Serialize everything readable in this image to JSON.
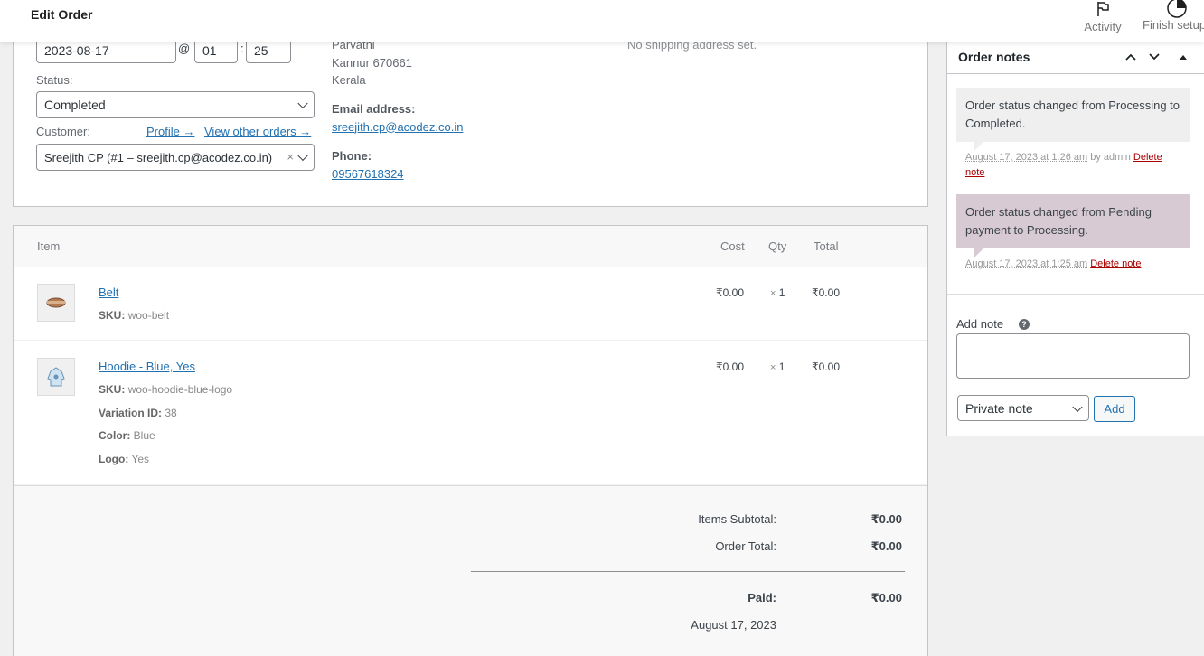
{
  "header": {
    "title": "Edit Order",
    "activity_label": "Activity",
    "finish_setup_label": "Finish setup"
  },
  "general": {
    "date": "2023-08-17",
    "at": "@",
    "hour": "01",
    "colon": ":",
    "minute": "25",
    "status_label": "Status:",
    "status_value": "Completed",
    "customer_label": "Customer:",
    "profile_link": "Profile →",
    "other_orders_link": "View other orders →",
    "customer_value": "Sreejith CP (#1 – sreejith.cp@acodez.co.in)",
    "clear_symbol": "×"
  },
  "billing": {
    "name": "Parvathi",
    "city": "Kannur 670661",
    "state": "Kerala",
    "email_label": "Email address:",
    "email": "sreejith.cp@acodez.co.in",
    "phone_label": "Phone:",
    "phone": "09567618324"
  },
  "shipping": {
    "empty_text": "No shipping address set."
  },
  "items": {
    "headers": {
      "item": "Item",
      "cost": "Cost",
      "qty": "Qty",
      "total": "Total"
    },
    "rows": [
      {
        "name": "Belt",
        "sku_label": "SKU:",
        "sku": "woo-belt",
        "cost": "₹0.00",
        "qty_x": "×",
        "qty": "1",
        "total": "₹0.00"
      },
      {
        "name": "Hoodie - Blue, Yes",
        "sku_label": "SKU:",
        "sku": "woo-hoodie-blue-logo",
        "variation_label": "Variation ID:",
        "variation": "38",
        "color_label": "Color:",
        "color": "Blue",
        "logo_label": "Logo:",
        "logo": "Yes",
        "cost": "₹0.00",
        "qty_x": "×",
        "qty": "1",
        "total": "₹0.00"
      }
    ]
  },
  "totals": {
    "subtotal_label": "Items Subtotal:",
    "subtotal": "₹0.00",
    "order_total_label": "Order Total:",
    "order_total": "₹0.00",
    "paid_label": "Paid:",
    "paid": "₹0.00",
    "paid_date": "August 17, 2023"
  },
  "notes": {
    "title": "Order notes",
    "list": [
      {
        "text": "Order status changed from Processing to Completed.",
        "date": "August 17, 2023 at 1:26 am",
        "by": "by admin",
        "delete": "Delete note"
      },
      {
        "text": "Order status changed from Pending payment to Processing.",
        "date": "August 17, 2023 at 1:25 am",
        "delete": "Delete note"
      }
    ],
    "add_label": "Add note",
    "help_symbol": "?",
    "type_value": "Private note",
    "add_button": "Add"
  },
  "colors": {
    "link": "#2271b1",
    "note_system": "#efefef",
    "note_customer": "#d7cad2",
    "delete_link": "#aa0000"
  }
}
